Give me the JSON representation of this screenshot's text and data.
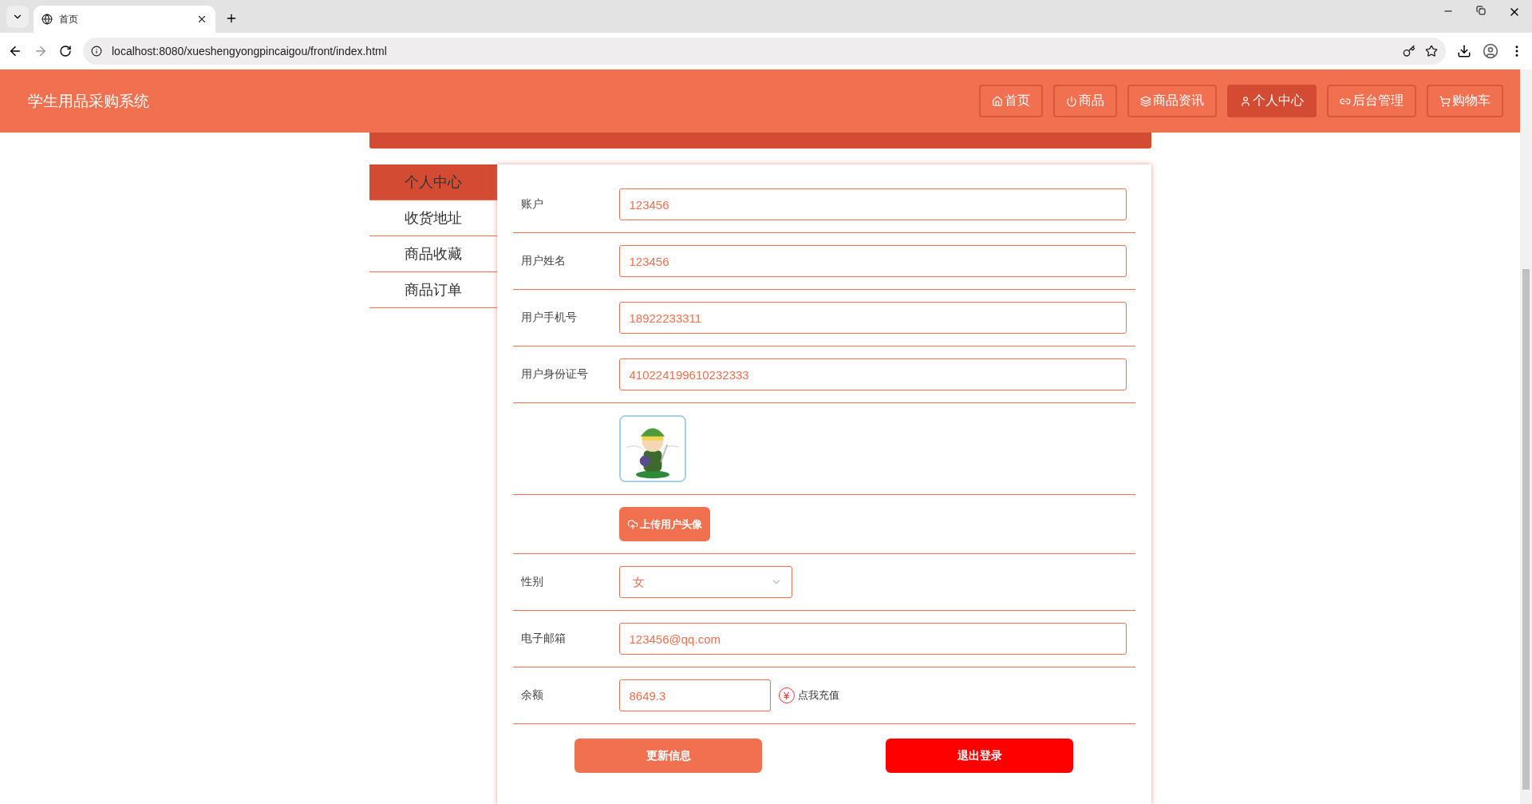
{
  "browser": {
    "tab_title": "首页",
    "url": "localhost:8080/xueshengyongpincaigou/front/index.html"
  },
  "header": {
    "title": "学生用品采购系统",
    "nav": [
      {
        "label": "首页",
        "selected": false
      },
      {
        "label": "商品",
        "selected": false
      },
      {
        "label": "商品资讯",
        "selected": false
      },
      {
        "label": "个人中心",
        "selected": true
      },
      {
        "label": "后台管理",
        "selected": false
      },
      {
        "label": "购物车",
        "selected": false
      }
    ]
  },
  "sidebar": {
    "items": [
      {
        "label": "个人中心",
        "selected": true
      },
      {
        "label": "收货地址",
        "selected": false
      },
      {
        "label": "商品收藏",
        "selected": false
      },
      {
        "label": "商品订单",
        "selected": false
      }
    ]
  },
  "form": {
    "rows": [
      {
        "kind": "text",
        "label": "账户",
        "value": "123456"
      },
      {
        "kind": "text",
        "label": "用户姓名",
        "value": "123456"
      },
      {
        "kind": "text",
        "label": "用户手机号",
        "value": "18922233311"
      },
      {
        "kind": "text",
        "label": "用户身份证号",
        "value": "410224199610232333"
      },
      {
        "kind": "avatar"
      },
      {
        "kind": "upload",
        "button": "上传用户头像"
      },
      {
        "kind": "select",
        "label": "性别",
        "value": "女"
      },
      {
        "kind": "text",
        "label": "电子邮箱",
        "value": "123456@qq.com"
      },
      {
        "kind": "balance",
        "label": "余额",
        "value": "8649.3",
        "symbol": "¥",
        "link": "点我充值"
      }
    ],
    "buttons": [
      {
        "label": "更新信息",
        "kind": "primary"
      },
      {
        "label": "退出登录",
        "kind": "danger"
      }
    ]
  }
}
